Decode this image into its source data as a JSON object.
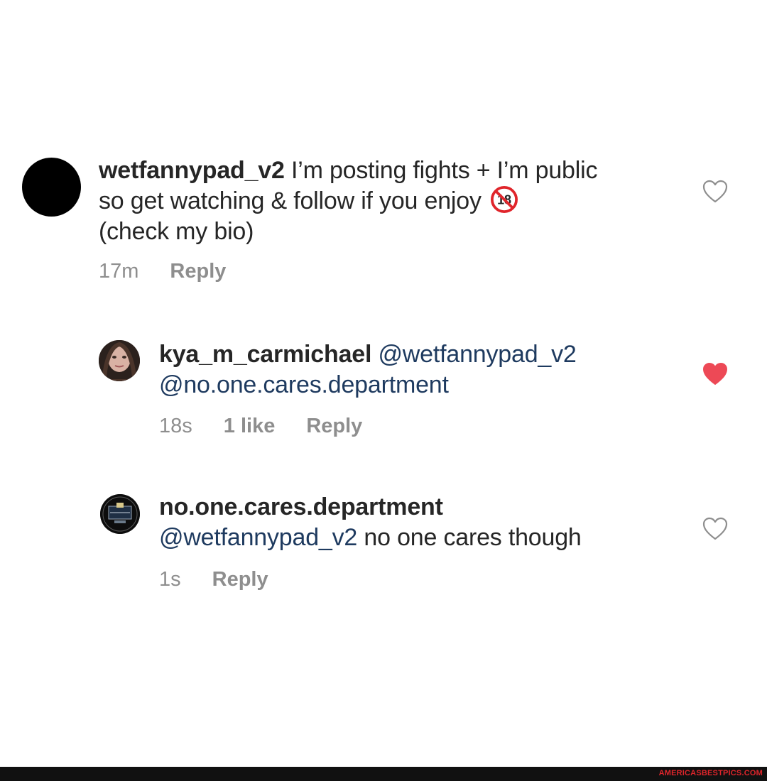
{
  "comments": [
    {
      "username": "wetfannypad_v2",
      "text_line1": " I’m posting fights + I’m public",
      "text_line2": "so get watching & follow if you enjoy ",
      "text_line3": "(check my bio)",
      "emoji": "no-under-18-emoji",
      "time": "17m",
      "reply_label": "Reply",
      "liked": false
    },
    {
      "username": "kya_m_carmichael",
      "mention1": " @wetfannypad_v2",
      "mention2": "@no.one.cares.department",
      "time": "18s",
      "likes_label": "1 like",
      "reply_label": "Reply",
      "liked": true
    },
    {
      "username": "no.one.cares.department",
      "mention1": "@wetfannypad_v2",
      "text": " no one cares though",
      "time": "1s",
      "reply_label": "Reply",
      "liked": false
    }
  ],
  "watermark": "AMERICASBESTPICS.COM",
  "colors": {
    "text": "#262626",
    "mention": "#1e3a5f",
    "meta": "#8e8e8e",
    "heart_liked": "#ed4956",
    "heart_outline": "#8e8e8e"
  }
}
